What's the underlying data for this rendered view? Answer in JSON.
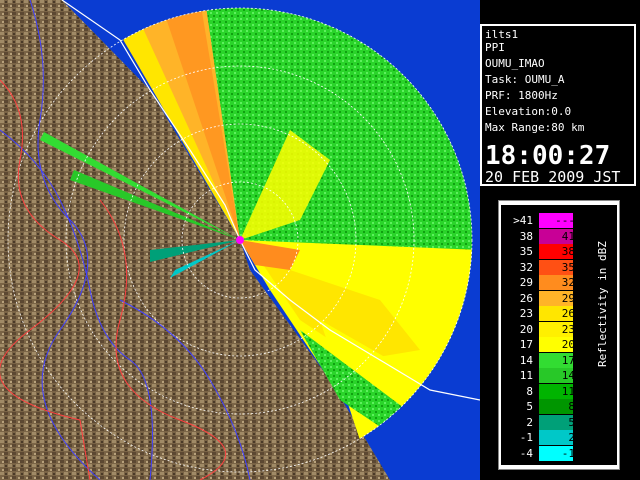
{
  "info": {
    "radar_name": "ilts1",
    "product": "PPI",
    "site": "OUMU_IMAO",
    "task": "Task: OUMU_A",
    "prf": "PRF: 1800Hz",
    "elevation": "Elevation:0.0",
    "max_range": "Max Range:80 km",
    "time": "18:00:27",
    "date": "20 FEB 2009 JST"
  },
  "legend": {
    "title": "Reflectivity in dBZ",
    "rows": [
      {
        "lo": ">41",
        "hi": "---",
        "color": "#ff00ff"
      },
      {
        "lo": "38",
        "hi": "41",
        "color": "#c80096"
      },
      {
        "lo": "35",
        "hi": "38",
        "color": "#ff0000"
      },
      {
        "lo": "32",
        "hi": "35",
        "color": "#ff5014"
      },
      {
        "lo": "29",
        "hi": "32",
        "color": "#ff8c1e"
      },
      {
        "lo": "26",
        "hi": "29",
        "color": "#ffb428"
      },
      {
        "lo": "23",
        "hi": "26",
        "color": "#ffe600"
      },
      {
        "lo": "20",
        "hi": "23",
        "color": "#fff000"
      },
      {
        "lo": "17",
        "hi": "20",
        "color": "#ffff00"
      },
      {
        "lo": "14",
        "hi": "17",
        "color": "#32dc32"
      },
      {
        "lo": "11",
        "hi": "14",
        "color": "#28c828"
      },
      {
        "lo": "8",
        "hi": "11",
        "color": "#00b400"
      },
      {
        "lo": "5",
        "hi": "8",
        "color": "#009600"
      },
      {
        "lo": "2",
        "hi": "5",
        "color": "#00a078"
      },
      {
        "lo": "-1",
        "hi": "2",
        "color": "#00c8c8"
      },
      {
        "lo": "-4",
        "hi": "-1",
        "color": "#00ffff"
      }
    ]
  },
  "colors": {
    "sea": "#0a3cd2",
    "land": "#7a6446",
    "range_ring": "#ffffff",
    "radar_origin": "#ff00ff"
  }
}
